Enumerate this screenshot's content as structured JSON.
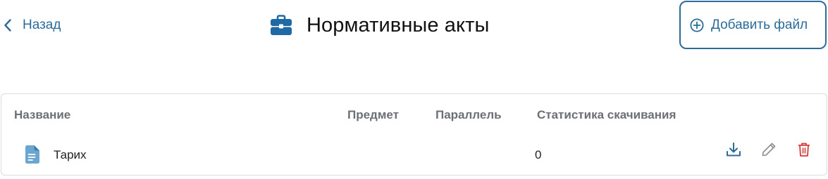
{
  "header": {
    "back_label": "Назад",
    "title": "Нормативные акты",
    "title_icon": "briefcase-icon",
    "add_button_label": "Добавить файл",
    "add_icon": "plus-circle-icon"
  },
  "table": {
    "columns": {
      "name": "Название",
      "subject": "Предмет",
      "grade": "Параллель",
      "downloads": "Статистика скачивания"
    },
    "rows": [
      {
        "name": "Тарих",
        "subject": "",
        "grade": "",
        "downloads": "0",
        "icon": "document-icon"
      }
    ],
    "row_actions": [
      "download-icon",
      "edit-pencil-icon",
      "trash-icon"
    ]
  },
  "colors": {
    "accent": "#2b6c98",
    "title_icon": "#1f6aa5",
    "file_icon": "#6aa6cf",
    "delete": "#d33b3b",
    "border": "#dadde1",
    "header_text": "#6c6f74"
  }
}
